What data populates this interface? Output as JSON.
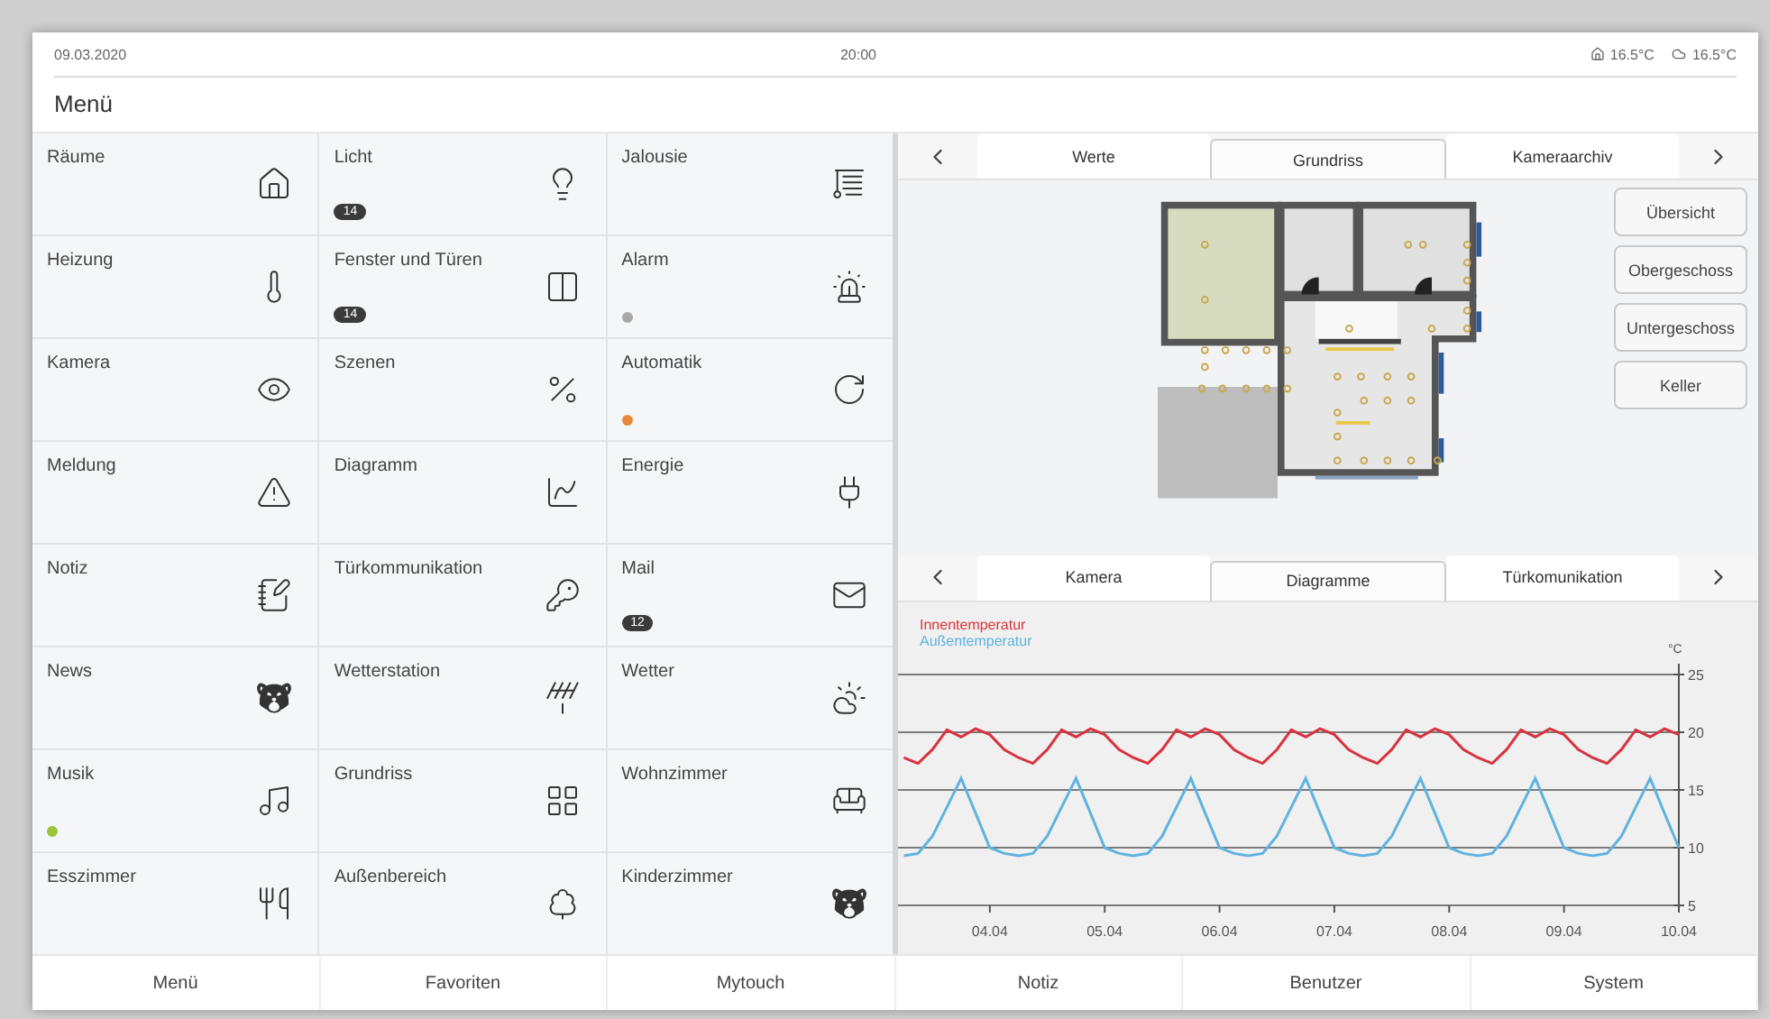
{
  "status_bar": {
    "date": "09.03.2020",
    "time": "20:00",
    "temperatures": [
      "16.5°C",
      "16.5°C"
    ]
  },
  "title": "Menü",
  "menu_tiles": [
    {
      "label": "Räume"
    },
    {
      "label": "Licht",
      "badge": "14"
    },
    {
      "label": "Jalousie"
    },
    {
      "label": "Heizung"
    },
    {
      "label": "Fenster und Türen",
      "badge": "14"
    },
    {
      "label": "Alarm",
      "color": "#a8a8a8"
    },
    {
      "label": "Kamera"
    },
    {
      "label": "Szenen"
    },
    {
      "label": "Automatik",
      "color": "#e8893a"
    },
    {
      "label": "Meldung"
    },
    {
      "label": "Diagramm"
    },
    {
      "label": "Energie"
    },
    {
      "label": "Notiz"
    },
    {
      "label": "Türkommunikation"
    },
    {
      "label": "Mail",
      "badge": "12"
    },
    {
      "label": "News"
    },
    {
      "label": "Wetterstation"
    },
    {
      "label": "Wetter"
    },
    {
      "label": "Musik",
      "color": "#9cc43a"
    },
    {
      "label": "Grundriss"
    },
    {
      "label": "Wohnzimmer"
    },
    {
      "label": "Esszimmer"
    },
    {
      "label": "Außenbereich"
    },
    {
      "label": "Kinderzimmer"
    }
  ],
  "top_tabs": [
    {
      "label": "Werte",
      "selected": false
    },
    {
      "label": "Grundriss",
      "selected": true
    },
    {
      "label": "Kameraarchiv",
      "selected": false
    }
  ],
  "floor_buttons": [
    "Übersicht",
    "Obergeschoss",
    "Untergeschoss",
    "Keller"
  ],
  "bottom_tabs": [
    {
      "label": "Kamera",
      "selected": false
    },
    {
      "label": "Diagramme",
      "selected": true
    },
    {
      "label": "Türkomunikation",
      "selected": false
    }
  ],
  "chart_data": {
    "type": "line",
    "ylabel": "°C",
    "ylim": [
      5,
      25
    ],
    "grid": true,
    "yticks": [
      5,
      10,
      15,
      20,
      25
    ],
    "categories": [
      null,
      null,
      null,
      null,
      null,
      null,
      "04.04",
      null,
      null,
      null,
      null,
      null,
      null,
      null,
      "05.04",
      null,
      null,
      null,
      null,
      null,
      null,
      null,
      "06.04",
      null,
      null,
      null,
      null,
      null,
      null,
      null,
      "07.04",
      null,
      null,
      null,
      null,
      null,
      null,
      null,
      "08.04",
      null,
      null,
      null,
      null,
      null,
      null,
      null,
      "09.04",
      null,
      null,
      null,
      null,
      null,
      null,
      null,
      "10.04"
    ],
    "series": [
      {
        "name": "Innentemperatur",
        "color": "#d9333f",
        "values": [
          17.8,
          17.3,
          18.5,
          20.2,
          19.6,
          20.3,
          19.8,
          18.5,
          17.8,
          17.3,
          18.5,
          20.2,
          19.6,
          20.3,
          19.8,
          18.5,
          17.8,
          17.3,
          18.5,
          20.2,
          19.6,
          20.3,
          19.8,
          18.5,
          17.8,
          17.3,
          18.5,
          20.2,
          19.6,
          20.3,
          19.8,
          18.5,
          17.8,
          17.3,
          18.5,
          20.2,
          19.6,
          20.3,
          19.8,
          18.5,
          17.8,
          17.3,
          18.5,
          20.2,
          19.6,
          20.3,
          19.8,
          18.5,
          17.8,
          17.3,
          18.5,
          20.2,
          19.6,
          20.3,
          19.8
        ]
      },
      {
        "name": "Außentemperatur",
        "color": "#5fb3e0",
        "values": [
          9.3,
          9.5,
          11,
          13.5,
          16,
          13,
          10,
          9.5,
          9.3,
          9.5,
          11,
          13.5,
          16,
          13,
          10,
          9.5,
          9.3,
          9.5,
          11,
          13.5,
          16,
          13,
          10,
          9.5,
          9.3,
          9.5,
          11,
          13.5,
          16,
          13,
          10,
          9.5,
          9.3,
          9.5,
          11,
          13.5,
          16,
          13,
          10,
          9.5,
          9.3,
          9.5,
          11,
          13.5,
          16,
          13,
          10,
          9.5,
          9.3,
          9.5,
          11,
          13.5,
          16,
          13,
          10
        ]
      }
    ]
  },
  "nav_buttons": [
    "Menü",
    "Favoriten",
    "Mytouch",
    "Notiz",
    "Benutzer",
    "System"
  ]
}
